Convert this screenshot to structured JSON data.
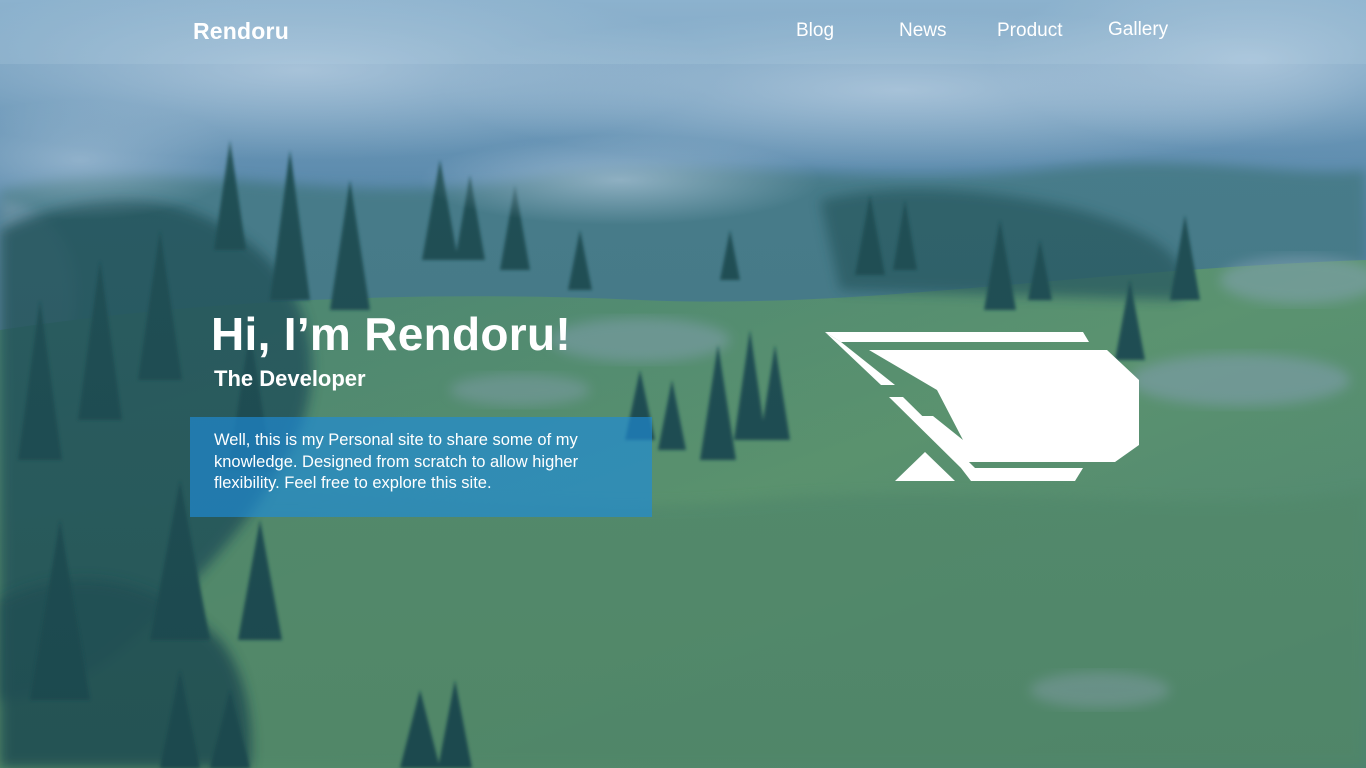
{
  "header": {
    "brand": "Rendoru",
    "nav": [
      {
        "label": "Blog"
      },
      {
        "label": "News"
      },
      {
        "label": "Product"
      },
      {
        "label": "Gallery"
      }
    ]
  },
  "hero": {
    "title": "Hi, I’m Rendoru!",
    "subtitle": "The Developer",
    "description": "Well, this is my Personal site to share some of my knowledge. Designed from scratch to allow higher flexibility. Feel free to explore this site."
  },
  "background": {
    "scene": "misty-mountain-forest",
    "colors": {
      "tint": "#2f6aa0",
      "grass": "#5f9a4c",
      "trees": "#1f4c3c",
      "mist": "#cfe0ea"
    }
  },
  "logo": {
    "icon": "rendoru-logo-icon",
    "color": "#ffffff"
  }
}
